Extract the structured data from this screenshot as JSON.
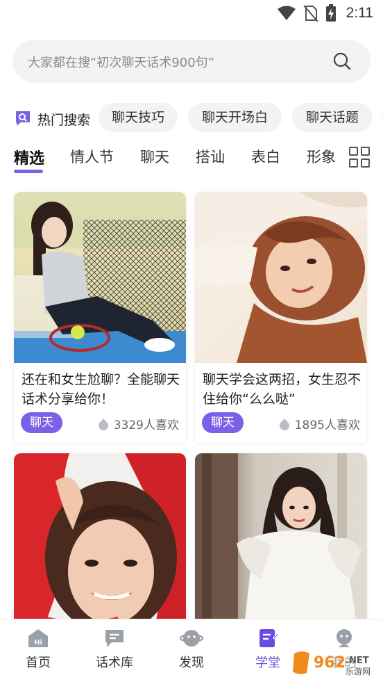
{
  "status_bar": {
    "time": "2:11",
    "icons": [
      "wifi-icon",
      "no-sim-icon",
      "battery-charging-icon"
    ]
  },
  "search": {
    "placeholder": "大家都在搜“初次聊天话术900句”",
    "icon": "search-icon"
  },
  "hot_search": {
    "title": "热门搜索",
    "icon": "hot-search-icon",
    "chips": [
      "聊天技巧",
      "聊天开场白",
      "聊天话题"
    ]
  },
  "tabs": {
    "items": [
      "精选",
      "情人节",
      "聊天",
      "搭讪",
      "表白",
      "形象"
    ],
    "active_index": 0,
    "more_icon": "grid-icon"
  },
  "cards": [
    {
      "title": "还在和女生尬聊？全能聊天话术分享给你！",
      "tag": "聊天",
      "likes": "3329人喜欢"
    },
    {
      "title": "聊天学会这两招，女生忍不住给你“么么哒”",
      "tag": "聊天",
      "likes": "1895人喜欢"
    },
    {
      "title": "",
      "tag": "",
      "likes": ""
    },
    {
      "title": "",
      "tag": "",
      "likes": ""
    }
  ],
  "bottom_nav": {
    "items": [
      {
        "label": "首页",
        "icon": "home-icon"
      },
      {
        "label": "话术库",
        "icon": "chat-library-icon"
      },
      {
        "label": "发现",
        "icon": "discover-icon"
      },
      {
        "label": "学堂",
        "icon": "classroom-icon"
      },
      {
        "label": "我的",
        "icon": "profile-icon"
      }
    ],
    "active_index": 3
  },
  "watermark": {
    "text": "962.NET",
    "subtext": "乐游网"
  },
  "colors": {
    "accent": "#7b61e6",
    "chip_bg": "#f3f3f5",
    "search_bg": "#f3f3f5"
  }
}
